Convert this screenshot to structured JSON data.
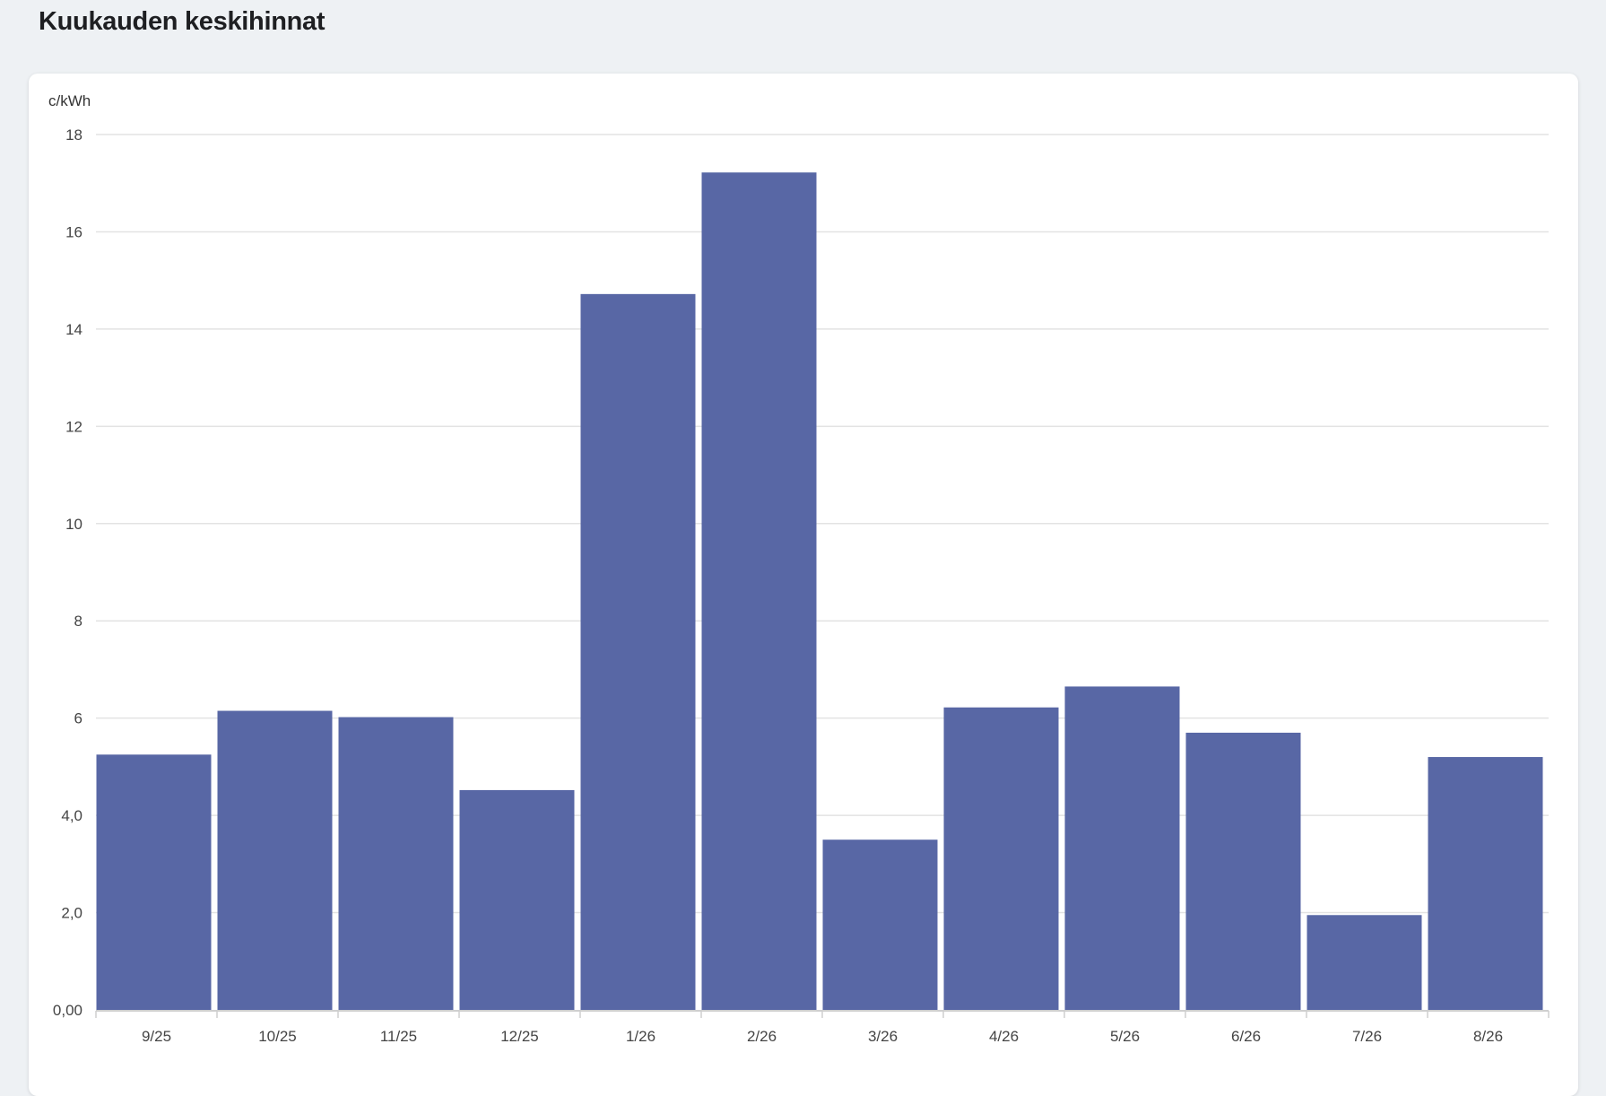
{
  "page": {
    "title": "Kuukauden keskihinnat"
  },
  "chart_data": {
    "type": "bar",
    "title": "",
    "xlabel": "",
    "ylabel": "c/kWh",
    "ylim": [
      0,
      18
    ],
    "grid": true,
    "bar_color": "#5867a5",
    "y_ticks": [
      {
        "value": 0,
        "label": "0,00"
      },
      {
        "value": 2,
        "label": "2,0"
      },
      {
        "value": 4,
        "label": "4,0"
      },
      {
        "value": 6,
        "label": "6"
      },
      {
        "value": 8,
        "label": "8"
      },
      {
        "value": 10,
        "label": "10"
      },
      {
        "value": 12,
        "label": "12"
      },
      {
        "value": 14,
        "label": "14"
      },
      {
        "value": 16,
        "label": "16"
      },
      {
        "value": 18,
        "label": "18"
      }
    ],
    "categories": [
      "9/25",
      "10/25",
      "11/25",
      "12/25",
      "1/26",
      "2/26",
      "3/26",
      "4/26",
      "5/26",
      "6/26",
      "7/26",
      "8/26"
    ],
    "values": [
      5.25,
      6.15,
      6.02,
      4.52,
      14.72,
      17.22,
      3.5,
      6.22,
      6.65,
      5.7,
      1.95,
      5.2
    ]
  }
}
